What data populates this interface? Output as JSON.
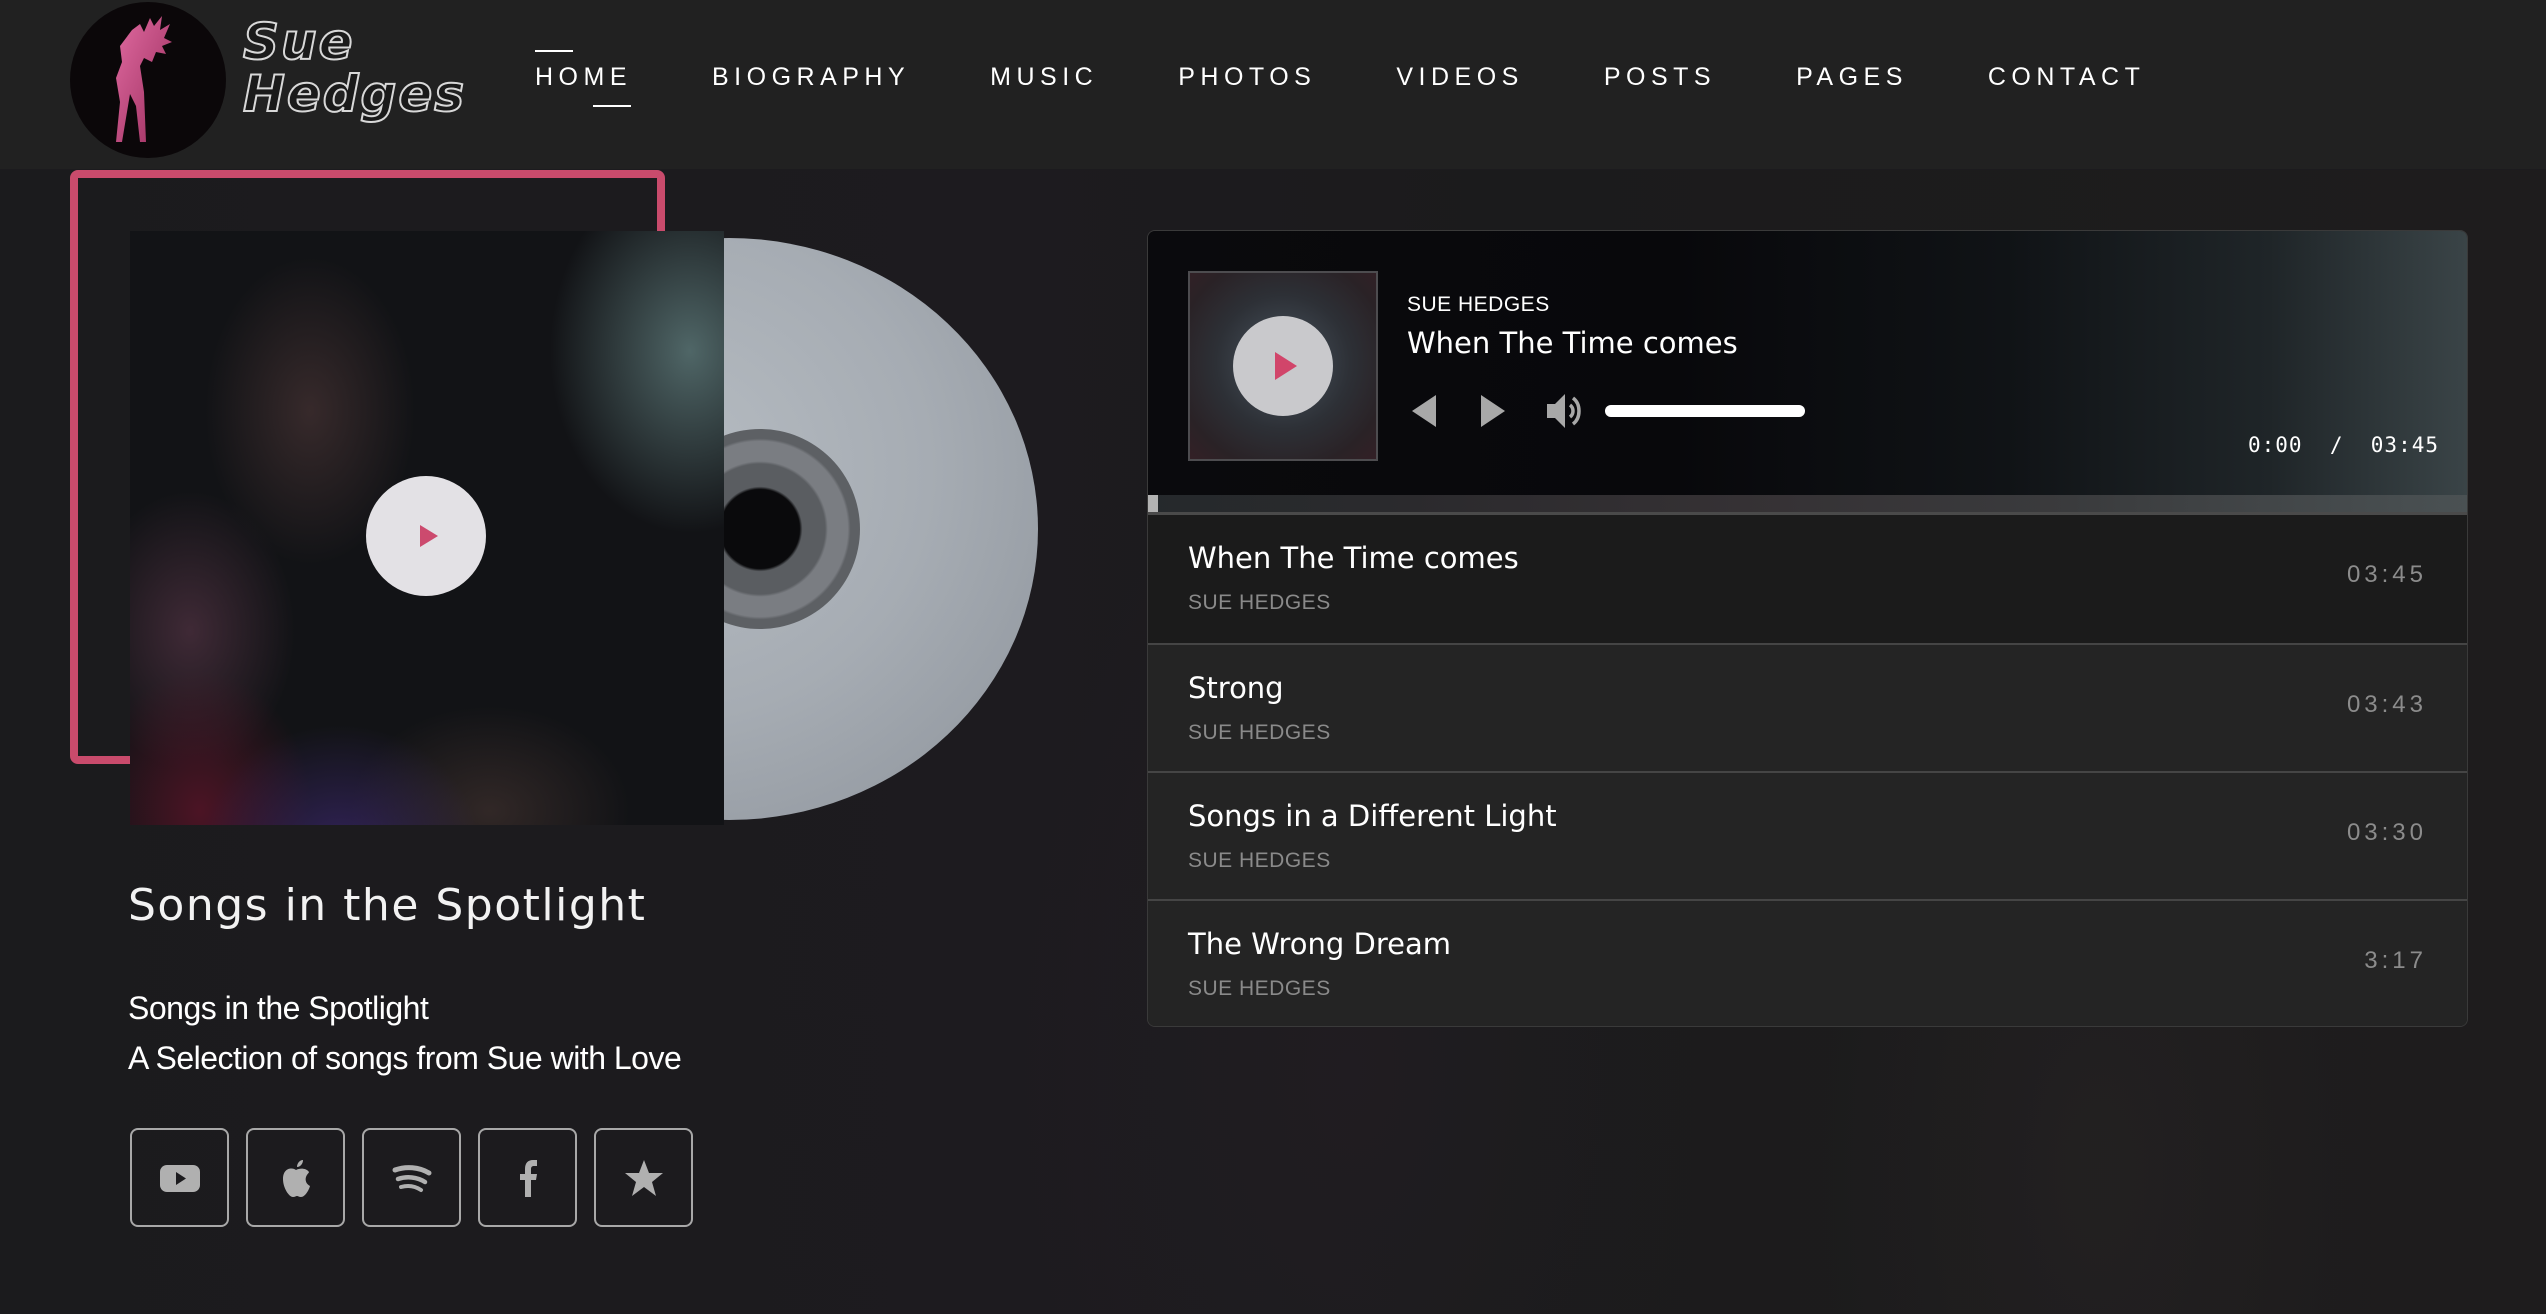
{
  "brand": {
    "name_line1": "Sue",
    "name_line2": "Hedges",
    "logo_icon": "dancer-silhouette-icon"
  },
  "nav": {
    "items": [
      {
        "label": "HOME",
        "active": true
      },
      {
        "label": "BIOGRAPHY",
        "active": false
      },
      {
        "label": "MUSIC",
        "active": false
      },
      {
        "label": "PHOTOS",
        "active": false
      },
      {
        "label": "VIDEOS",
        "active": false
      },
      {
        "label": "POSTS",
        "active": false
      },
      {
        "label": "PAGES",
        "active": false
      },
      {
        "label": "CONTACT",
        "active": false
      }
    ]
  },
  "colors": {
    "accent": "#c94b6c",
    "header_bg": "#212121",
    "page_bg": "#1c1b1e",
    "track_bg": "#242424",
    "track_active_bg": "#1b1b1b"
  },
  "spotlight": {
    "heading": "Songs in the Spotlight",
    "subtitle_line1": "Songs in the Spotlight",
    "subtitle_line2": "A Selection of songs from Sue with Love",
    "album_play_icon": "play-icon",
    "socials": [
      {
        "name": "youtube",
        "icon": "youtube-icon"
      },
      {
        "name": "apple-music",
        "icon": "apple-icon"
      },
      {
        "name": "spotify",
        "icon": "spotify-icon"
      },
      {
        "name": "facebook",
        "icon": "facebook-icon"
      },
      {
        "name": "favorite",
        "icon": "star-icon"
      }
    ]
  },
  "player": {
    "now_playing": {
      "artist": "SUE HEDGES",
      "title": "When The Time comes",
      "current_time": "0:00",
      "separator": "/",
      "duration": "03:45",
      "progress_percent": 0,
      "volume_percent": 100
    },
    "controls": {
      "prev_icon": "previous-icon",
      "next_icon": "next-icon",
      "volume_icon": "volume-icon"
    },
    "tracks": [
      {
        "title": "When The Time comes",
        "artist": "SUE HEDGES",
        "duration": "03:45",
        "active": true
      },
      {
        "title": "Strong",
        "artist": "SUE HEDGES",
        "duration": "03:43",
        "active": false
      },
      {
        "title": "Songs in a Different Light",
        "artist": "SUE HEDGES",
        "duration": "03:30",
        "active": false
      },
      {
        "title": "The Wrong Dream",
        "artist": "SUE HEDGES",
        "duration": "3:17",
        "active": false
      }
    ]
  }
}
